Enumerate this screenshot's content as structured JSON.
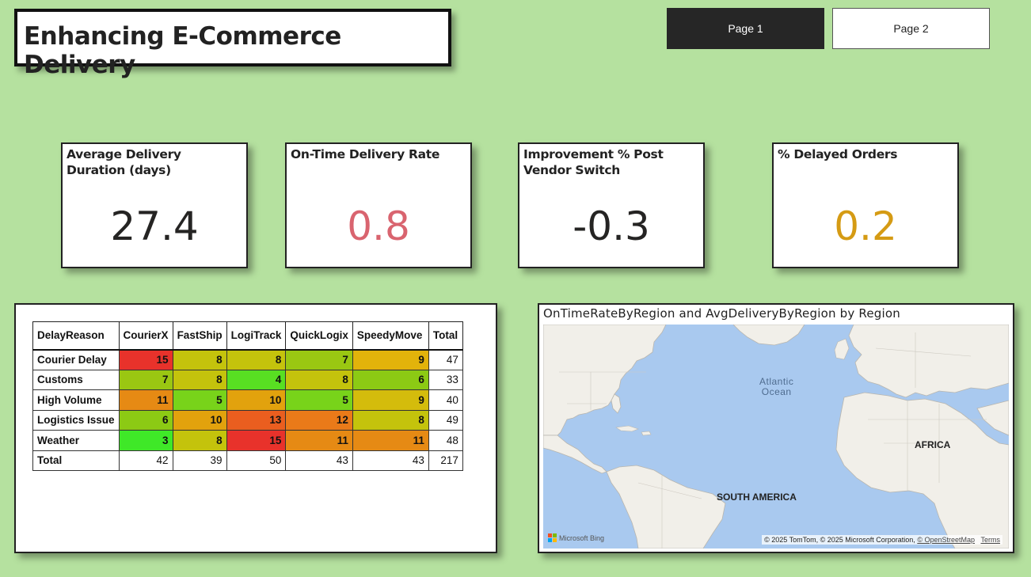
{
  "header": {
    "title": "Enhancing E-Commerce Delivery"
  },
  "nav": {
    "page1_label": "Page 1",
    "page2_label": "Page 2",
    "active": "Page 1"
  },
  "kpis": [
    {
      "label": "Average Delivery Duration (days)",
      "value": "27.4",
      "color": "#252423"
    },
    {
      "label": "On-Time Delivery Rate",
      "value": "0.8",
      "color": "#d9646f"
    },
    {
      "label": "Improvement % Post Vendor Switch",
      "value": "-0.3",
      "color": "#252423"
    },
    {
      "label": "% Delayed Orders",
      "value": "0.2",
      "color": "#d59b14"
    }
  ],
  "matrix": {
    "columns": [
      "DelayReason",
      "CourierX",
      "FastShip",
      "LogiTrack",
      "QuickLogix",
      "SpeedyMove",
      "Total"
    ],
    "rows": [
      {
        "label": "Courier Delay",
        "values": [
          15,
          8,
          8,
          7,
          9
        ],
        "total": 47,
        "colors": [
          "#e8322b",
          "#c4c30c",
          "#c4c30c",
          "#9ac712",
          "#e2b30b"
        ]
      },
      {
        "label": "Customs",
        "values": [
          7,
          8,
          4,
          8,
          6
        ],
        "total": 33,
        "colors": [
          "#9ac712",
          "#c4c30c",
          "#58df22",
          "#c4c30c",
          "#8cca14"
        ]
      },
      {
        "label": "High Volume",
        "values": [
          11,
          5,
          10,
          5,
          9
        ],
        "total": 40,
        "colors": [
          "#e68a14",
          "#78d31a",
          "#e2a20d",
          "#78d31a",
          "#d4bc0c"
        ]
      },
      {
        "label": "Logistics Issue",
        "values": [
          6,
          10,
          13,
          12,
          8
        ],
        "total": 49,
        "colors": [
          "#8cca14",
          "#e2a20d",
          "#ea5e1f",
          "#ea7a19",
          "#c4c30c"
        ]
      },
      {
        "label": "Weather",
        "values": [
          3,
          8,
          15,
          11,
          11
        ],
        "total": 48,
        "colors": [
          "#3fe828",
          "#c4c30c",
          "#e8322b",
          "#e68a14",
          "#e68a14"
        ]
      }
    ],
    "totals_row": {
      "label": "Total",
      "values": [
        42,
        39,
        50,
        43,
        43
      ],
      "total": 217
    }
  },
  "map": {
    "title": "OnTimeRateByRegion and AvgDeliveryByRegion by Region",
    "labels": {
      "ocean_line1": "Atlantic",
      "ocean_line2": "Ocean",
      "africa": "AFRICA",
      "south_america": "SOUTH AMERICA"
    },
    "bing": "Microsoft Bing",
    "attribution_text": "© 2025 TomTom, © 2025 Microsoft Corporation, ",
    "attribution_link1": "© OpenStreetMap",
    "attribution_link2": "Terms"
  }
}
